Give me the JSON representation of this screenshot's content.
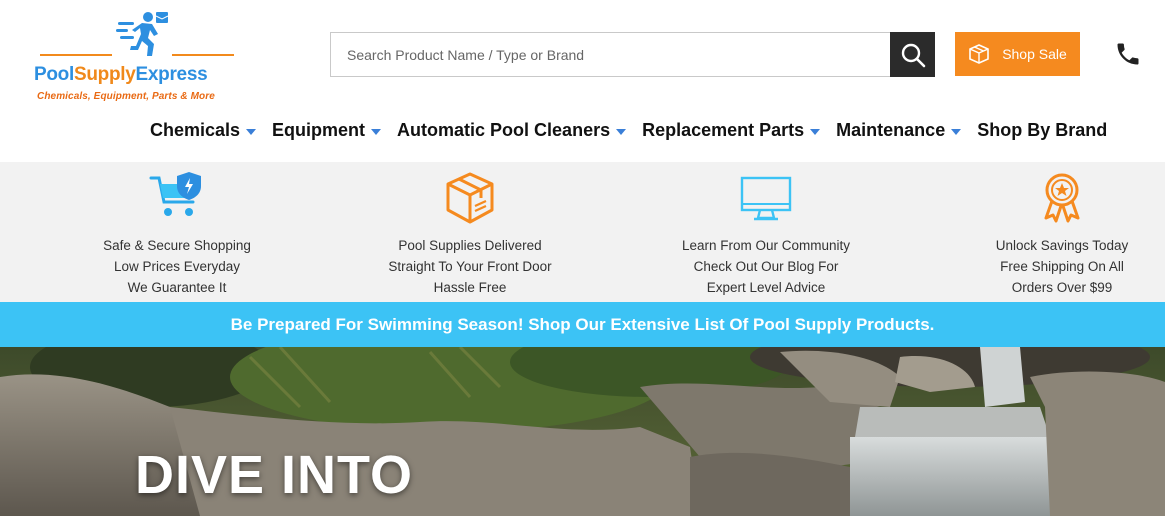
{
  "logo": {
    "name_part1": "Pool",
    "name_part2": "Supply",
    "name_part3": "Express",
    "tagline": "Chemicals, Equipment, Parts & More"
  },
  "search": {
    "placeholder": "Search Product Name / Type or Brand",
    "icon": "search-icon"
  },
  "shop_sale": {
    "label": "Shop Sale",
    "icon": "box-icon"
  },
  "phone": {
    "icon": "phone-icon"
  },
  "nav": [
    {
      "label": "Chemicals",
      "has_dropdown": true
    },
    {
      "label": "Equipment",
      "has_dropdown": true
    },
    {
      "label": "Automatic Pool Cleaners",
      "has_dropdown": true
    },
    {
      "label": "Replacement Parts",
      "has_dropdown": true
    },
    {
      "label": "Maintenance",
      "has_dropdown": true
    },
    {
      "label": "Shop By Brand",
      "has_dropdown": false
    }
  ],
  "features": [
    {
      "icon": "shopping-cart-shield-icon",
      "lines": [
        "Safe & Secure Shopping",
        "Low Prices Everyday",
        "We Guarantee It"
      ]
    },
    {
      "icon": "package-icon",
      "lines": [
        "Pool Supplies Delivered",
        "Straight To Your Front Door",
        "Hassle Free"
      ]
    },
    {
      "icon": "monitor-icon",
      "lines": [
        "Learn From Our Community",
        "Check Out Our Blog For",
        "Expert Level Advice"
      ]
    },
    {
      "icon": "award-ribbon-icon",
      "lines": [
        "Unlock Savings Today",
        "Free Shipping On All",
        "Orders Over $99"
      ]
    }
  ],
  "banner": {
    "text": "Be Prepared For Swimming Season! Shop Our Extensive List Of Pool Supply Products."
  },
  "hero": {
    "title": "DIVE INTO"
  },
  "colors": {
    "accent_orange": "#f58a1f",
    "accent_blue": "#3cc3f5",
    "logo_blue": "#2d8fe0",
    "dark": "#2b2b2b"
  }
}
